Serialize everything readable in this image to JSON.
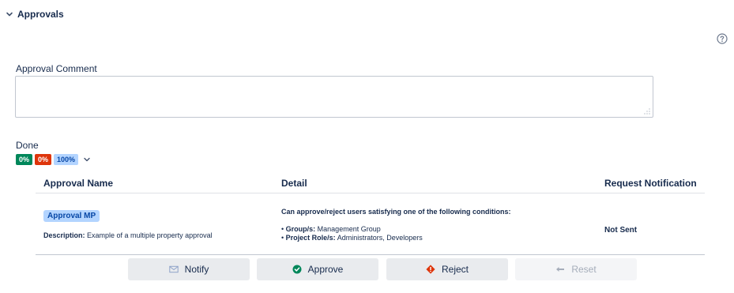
{
  "section": {
    "title": "Approvals",
    "help_icon": "help-circle-icon"
  },
  "comment": {
    "label": "Approval Comment",
    "value": ""
  },
  "status": {
    "label": "Done",
    "progress": [
      {
        "text": "0%",
        "color": "#00875a"
      },
      {
        "text": "0%",
        "color": "#de350b"
      },
      {
        "text": "100%",
        "color": "#b3d4ff"
      }
    ]
  },
  "table": {
    "headers": [
      "Approval Name",
      "Detail",
      "Request Notification"
    ],
    "rows": [
      {
        "name": "Approval MP",
        "description_label": "Description:",
        "description": "Example of a multiple property approval",
        "detail_heading": "Can approve/reject users satisfying one of the following conditions:",
        "conditions": [
          {
            "label": "Group/s:",
            "value": "Management Group"
          },
          {
            "label": "Project Role/s:",
            "value": "Administrators, Developers"
          }
        ],
        "notification": "Not Sent"
      }
    ]
  },
  "buttons": {
    "notify": "Notify",
    "approve": "Approve",
    "reject": "Reject",
    "reset": "Reset"
  },
  "icons": {
    "notify": "envelope-icon",
    "approve": "check-circle-icon",
    "reject": "reject-diamond-icon",
    "reset": "undo-arrow-icon"
  }
}
